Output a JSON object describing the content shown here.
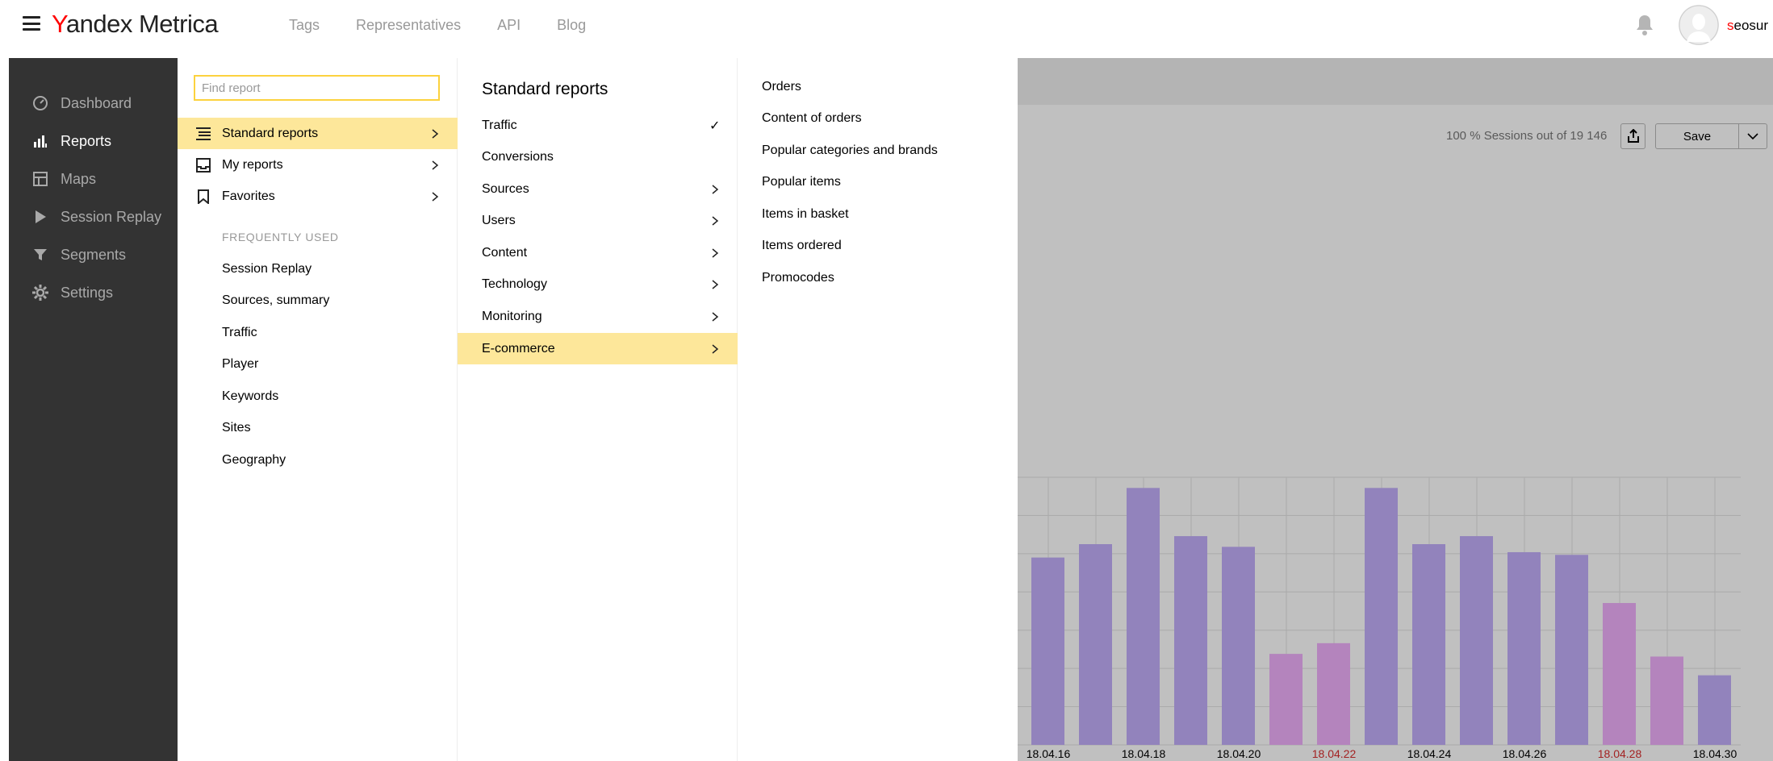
{
  "header": {
    "logo_first": "Y",
    "logo_rest": "andex Metrica",
    "nav": [
      "Tags",
      "Representatives",
      "API",
      "Blog"
    ],
    "user_first": "s",
    "user_rest": "eosur"
  },
  "sidebar": {
    "items": [
      {
        "label": "Dashboard",
        "icon": "gauge-icon"
      },
      {
        "label": "Reports",
        "icon": "bar-chart-icon",
        "active": true
      },
      {
        "label": "Maps",
        "icon": "map-icon"
      },
      {
        "label": "Session Replay",
        "icon": "play-icon"
      },
      {
        "label": "Segments",
        "icon": "filter-icon"
      },
      {
        "label": "Settings",
        "icon": "gear-icon"
      }
    ]
  },
  "menu": {
    "search_placeholder": "Find report",
    "categories": [
      {
        "label": "Standard reports",
        "icon": "list-icon",
        "selected": true
      },
      {
        "label": "My reports",
        "icon": "inbox-icon"
      },
      {
        "label": "Favorites",
        "icon": "bookmark-icon"
      }
    ],
    "frequently_used_title": "FREQUENTLY USED",
    "frequently_used": [
      "Session Replay",
      "Sources, summary",
      "Traffic",
      "Player",
      "Keywords",
      "Sites",
      "Geography"
    ]
  },
  "standard_reports": {
    "title": "Standard reports",
    "items": [
      {
        "label": "Traffic",
        "checked": true
      },
      {
        "label": "Conversions"
      },
      {
        "label": "Sources",
        "submenu": true
      },
      {
        "label": "Users",
        "submenu": true
      },
      {
        "label": "Content",
        "submenu": true
      },
      {
        "label": "Technology",
        "submenu": true
      },
      {
        "label": "Monitoring",
        "submenu": true
      },
      {
        "label": "E-commerce",
        "submenu": true,
        "selected": true
      }
    ]
  },
  "ecommerce": {
    "items": [
      "Orders",
      "Content of orders",
      "Popular categories and brands",
      "Popular items",
      "Items in basket",
      "Items ordered",
      "Promocodes"
    ]
  },
  "toolbar": {
    "sessions_text": "100 % Sessions out of 19 146",
    "save_label": "Save"
  },
  "colors": {
    "accent_yellow": "#fde79a",
    "search_border": "#fcd23e",
    "weekday_bar": "#9283bc",
    "weekend_bar": "#b484bd",
    "weekend_label": "#a32222"
  },
  "chart_data": {
    "type": "bar",
    "x_tick_labels": [
      "18.04.16",
      "18.04.18",
      "18.04.20",
      "18.04.22",
      "18.04.24",
      "18.04.26",
      "18.04.28",
      "18.04.30"
    ],
    "weekend_ticks": [
      "18.04.22",
      "18.04.28"
    ],
    "values": [
      70,
      75,
      96,
      78,
      74,
      34,
      38,
      96,
      75,
      78,
      72,
      71,
      53,
      33,
      26
    ],
    "weekend": [
      false,
      false,
      false,
      false,
      false,
      true,
      true,
      false,
      false,
      false,
      false,
      false,
      true,
      true,
      false
    ],
    "ylim": [
      0,
      100
    ],
    "grid": true
  }
}
